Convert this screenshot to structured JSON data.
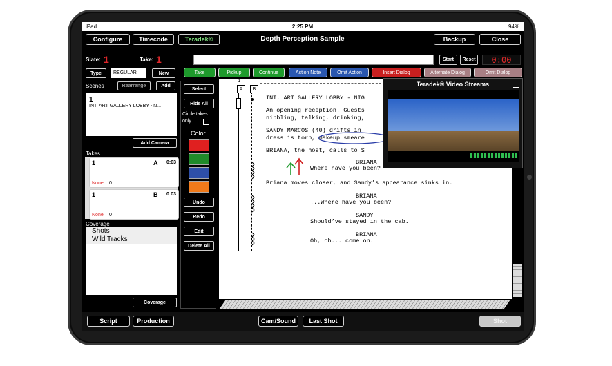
{
  "status": {
    "carrier": "iPad",
    "time": "2:25 PM",
    "battery": "94%"
  },
  "header": {
    "title": "Depth Perception Sample",
    "configure": "Configure",
    "timecode": "Timecode",
    "teradek": "Teradek®",
    "backup": "Backup",
    "close": "Close"
  },
  "slate": {
    "label": "Slate:",
    "value": "1"
  },
  "take": {
    "label": "Take:",
    "value": "1"
  },
  "controls": {
    "start": "Start",
    "reset": "Reset",
    "timer": "0:00"
  },
  "type_row": {
    "type": "Type",
    "value": "REGULAR",
    "new": "New"
  },
  "toolbar": [
    {
      "label": "Take",
      "color": "#1e9a2c"
    },
    {
      "label": "Pickup",
      "color": "#1e9a2c"
    },
    {
      "label": "Continue",
      "color": "#1e9a2c"
    },
    {
      "label": "Action Note",
      "color": "#2a57b0"
    },
    {
      "label": "Omit Action",
      "color": "#2a57b0"
    },
    {
      "label": "Insert Dialog",
      "color": "#c91f1f"
    },
    {
      "label": "Alternate Dialog",
      "color": "#a87f84"
    },
    {
      "label": "Omit Dialog",
      "color": "#a87f84"
    }
  ],
  "scenes": {
    "label": "Scenes",
    "rearrange": "Rearrange",
    "add": "Add",
    "items": [
      {
        "number": "1",
        "title": "INT. ART GALLERY LOBBY - N..."
      }
    ],
    "add_camera": "Add Camera"
  },
  "takes": {
    "label": "Takes",
    "items": [
      {
        "number": "1",
        "camera": "A",
        "duration": "0:03",
        "circle": "None",
        "count": "0"
      },
      {
        "number": "1",
        "camera": "B",
        "duration": "0:03",
        "circle": "None",
        "count": "0"
      }
    ]
  },
  "coverage": {
    "label": "Coverage",
    "items": [
      "Shots",
      "Wild Tracks"
    ],
    "button": "Coverage"
  },
  "tools": {
    "select": "Select",
    "hide_all": "Hide All",
    "circle_takes": "Circle takes only",
    "color_label": "Color",
    "colors": [
      "#e02020",
      "#1f8a2a",
      "#2e4fa8",
      "#f07a1a"
    ],
    "undo": "Undo",
    "redo": "Redo",
    "edit": "Edit",
    "delete_all": "Delete All"
  },
  "script": {
    "markers": [
      "1",
      "A",
      "B"
    ],
    "lines": [
      "INT. ART GALLERY LOBBY - NIG",
      "An opening reception. Guests",
      "nibbling, talking, drinking,",
      "SANDY MARCOS (40) drifts in",
      "dress is torn, makeup smeare",
      "BRIANA, the host, calls to S",
      "BRIANA",
      "Where have you been?",
      "Briana moves closer, and Sandy’s appearance sinks in.",
      "BRIANA",
      "...Where have you been?",
      "SANDY",
      "Should’ve stayed in the cab.",
      "BRIANA",
      "Oh, oh... come on."
    ]
  },
  "video": {
    "title": "Teradek® Video Streams"
  },
  "bottom": {
    "script": "Script",
    "production": "Production",
    "cam_sound": "Cam/Sound",
    "last_shot": "Last Shot",
    "shot": "Shot"
  }
}
